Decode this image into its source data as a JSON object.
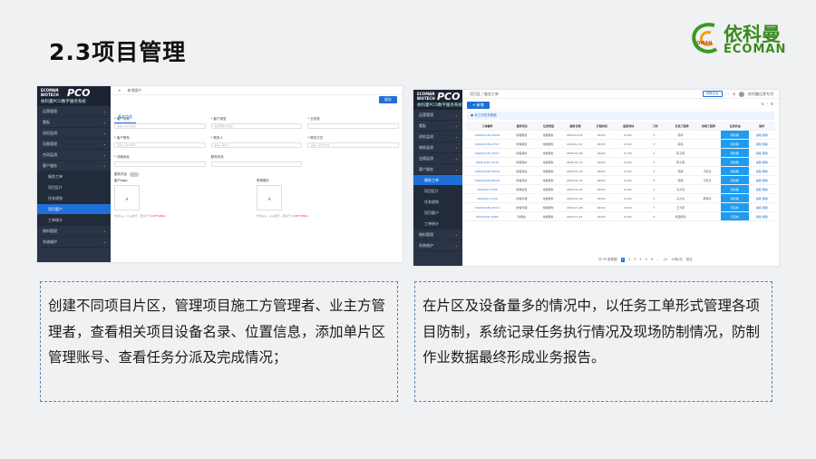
{
  "slide": {
    "title": "2.3项目管理",
    "logo": {
      "cn": "依科曼",
      "en": "ECOMAN",
      "tag": "OMAN"
    }
  },
  "shot1": {
    "brand_line1": "ECOMAN",
    "brand_line2": "BIOTECH",
    "brand_pco": "PCO",
    "brand_sub": "依科曼PCO数字服务系统",
    "menu": [
      {
        "label": "运营管理",
        "type": "top"
      },
      {
        "label": "看板",
        "type": "top"
      },
      {
        "label": "巡检监测",
        "type": "top"
      },
      {
        "label": "设备管理",
        "type": "top"
      },
      {
        "label": "合同监测",
        "type": "top"
      },
      {
        "label": "客户服务",
        "type": "top"
      },
      {
        "label": "服务工单",
        "type": "child"
      },
      {
        "label": "项目区片",
        "type": "child"
      },
      {
        "label": "任务规划",
        "type": "child"
      },
      {
        "label": "项目客户",
        "type": "active"
      },
      {
        "label": "工单统计",
        "type": "child"
      },
      {
        "label": "物料管理",
        "type": "top"
      },
      {
        "label": "系统维护",
        "type": "top"
      }
    ],
    "breadcrumb": "新增客户",
    "save": "保存",
    "tab": "基本信息",
    "fields_row1": [
      {
        "label": "* 客户名称",
        "placeholder": "请输入客户名称"
      },
      {
        "label": "* 客户类型",
        "placeholder": "请选择客户类型"
      },
      {
        "label": "* 业务类",
        "placeholder": ""
      }
    ],
    "fields_row2": [
      {
        "label": "* 客户联系",
        "placeholder": "请输入客户联系"
      },
      {
        "label": "* 联系人",
        "placeholder": "请输入联系人"
      },
      {
        "label": "* 联系方式",
        "placeholder": "请输入联系方式"
      }
    ],
    "fields_row3": [
      {
        "label": "* 详细地址",
        "placeholder": ""
      },
      {
        "label": "服务状态",
        "placeholder": ""
      },
      {
        "label": "",
        "placeholder": ""
      }
    ],
    "switch_label": "服务开启",
    "upload1": {
      "label": "客户logo",
      "hint": "支持jpg、png格式，建议尺寸",
      "hint_red": "128*128px"
    },
    "upload2": {
      "label": "现场照片",
      "hint": "支持jpg、png格式，建议尺寸",
      "hint_red": "128*128px"
    }
  },
  "shot2": {
    "brand_line1": "ECOMAN",
    "brand_line2": "BIOTECH",
    "brand_pco": "PCO",
    "brand_sub": "依科曼PCO数字服务系统",
    "menu": [
      {
        "label": "运营管理",
        "type": "top"
      },
      {
        "label": "看板",
        "type": "top"
      },
      {
        "label": "巡检监测",
        "type": "top"
      },
      {
        "label": "物联监测",
        "type": "top"
      },
      {
        "label": "虫情监测",
        "type": "top"
      },
      {
        "label": "客户服务",
        "type": "top"
      },
      {
        "label": "服务工单",
        "type": "active"
      },
      {
        "label": "项目区片",
        "type": "child"
      },
      {
        "label": "任务规划",
        "type": "child"
      },
      {
        "label": "项目客户",
        "type": "child"
      },
      {
        "label": "工单统计",
        "type": "child"
      },
      {
        "label": "物料管理",
        "type": "top"
      },
      {
        "label": "系统维护",
        "type": "top"
      }
    ],
    "breadcrumb": "项目区 / 服务工单",
    "topbtn": "切换平台",
    "user": "依科曼运营专用",
    "add": "+ 新增",
    "filter": "本工作任务数据",
    "columns": [
      "工单编号",
      "服务项目",
      "任务类型",
      "服务日期",
      "开始时间",
      "结束时间",
      "工时",
      "负责工程师",
      "协助工程师",
      "任务状态",
      "操作"
    ],
    "rows": [
      [
        "2024/01/30-04/28",
        "防霉服务",
        "常规服务",
        "2024-10-31",
        "09:00",
        "12:00",
        "3",
        "陈科",
        "",
        "待处理",
        "编辑 删除"
      ],
      [
        "2024/01/30-07/27",
        "防霉服务",
        "常规服务",
        "2024-11-11",
        "09:00",
        "12:00",
        "3",
        "陈科",
        "",
        "待处理",
        "编辑 删除"
      ],
      [
        "2024/01/30-03/27",
        "防霉保护",
        "常规服务",
        "2025-01-06",
        "09:00",
        "11:00",
        "2",
        "陈子辉",
        "",
        "待处理",
        "编辑 删除"
      ],
      [
        "2024/1/30-74/76",
        "防霉保护",
        "常规服务",
        "2025-01-10",
        "09:00",
        "12:00",
        "3",
        "陈子辉",
        "",
        "待处理",
        "编辑 删除"
      ],
      [
        "2024/01/08-50/29",
        "防霉通道",
        "常规服务",
        "2025-01-18",
        "09:00",
        "12:00",
        "3",
        "陈辉",
        "刁晓涛",
        "待处理",
        "编辑 删除"
      ],
      [
        "2024/01/08-60/28",
        "防霉通道",
        "常规服务",
        "2025-01-21",
        "09:00",
        "12:00",
        "3",
        "陈辉",
        "刁晓涛",
        "待处理",
        "编辑 删除"
      ],
      [
        "2024/02-12/36",
        "防霉检查",
        "常规服务",
        "2025-01-22",
        "09:00",
        "12:00",
        "3",
        "马力涛",
        "",
        "待处理",
        "编辑 删除"
      ],
      [
        "2024/02-11/36",
        "防霉处理",
        "常规服务",
        "2025-01-22",
        "09:00",
        "12:00",
        "3",
        "马力涛",
        "黄辉伟",
        "待处理",
        "编辑 删除"
      ],
      [
        "2024/01/30-07/21",
        "防霉处理",
        "常规服务",
        "2024-11-26",
        "09:00",
        "16:00",
        "7",
        "王力军",
        "",
        "已完成",
        "编辑 删除"
      ],
      [
        "2024/106-70/28",
        "防霉的",
        "常规服务",
        "2024-11-27",
        "09:00",
        "12:00",
        "3",
        "熊铭明涛",
        "",
        "已完成",
        "编辑 删除"
      ]
    ],
    "pager": {
      "total": "共 99 条数据",
      "pages": [
        "1",
        "2",
        "3",
        "4",
        "5",
        "6",
        "…",
        "10"
      ],
      "current": "1",
      "size": "10条/页",
      "goto": "前往"
    }
  },
  "text_left": "创建不同项目片区，管理项目施工方管理者、业主方管理者，查看相关项目设备名录、位置信息，添加单片区管理账号、查看任务分派及完成情况；",
  "text_right": "在片区及设备量多的情况中，以任务工单形式管理各项目防制，系统记录任务执行情况及现场防制情况，防制作业数据最终形成业务报告。"
}
